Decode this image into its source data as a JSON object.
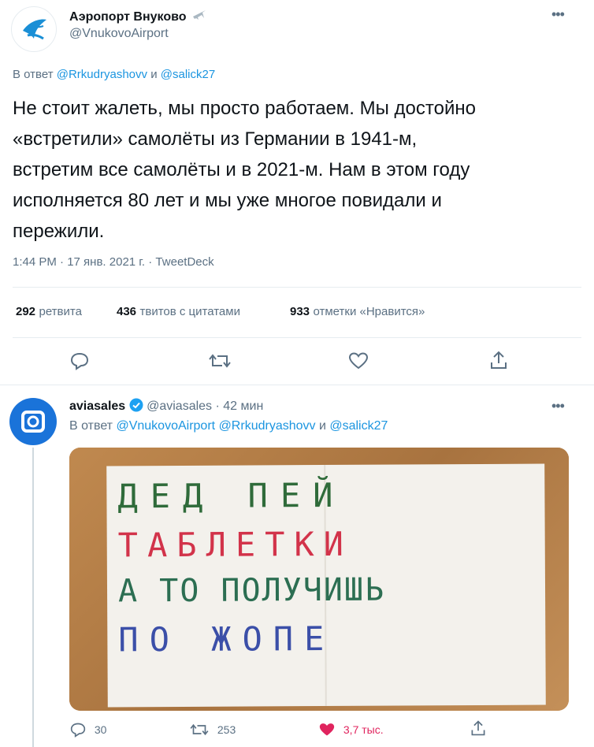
{
  "tweet1": {
    "author_name": "Аэропорт Внуково",
    "author_handle": "@VnukovoAirport",
    "reply_prefix": "В ответ",
    "reply_to_1": "@Rrkudryashovv",
    "reply_and": "и",
    "reply_to_2": "@salick27",
    "text_lines": [
      "Не стоит жалеть, мы просто работаем. Мы достойно",
      "«встретили» самолёты из Германии в 1941-м,",
      "встретим все самолёты и в 2021-м. Нам в этом году",
      "исполняется 80 лет и мы уже многое повидали и",
      "пережили."
    ],
    "meta": "1:44 PM · 17 янв. 2021 г. · TweetDeck",
    "stats": {
      "retweets_count": "292",
      "retweets_label": "ретвита",
      "quotes_count": "436",
      "quotes_label": "твитов с цитатами",
      "likes_count": "933",
      "likes_label": "отметки «Нравится»"
    }
  },
  "tweet2": {
    "author_name": "aviasales",
    "author_handle": "@aviasales",
    "time": "· 42 мин",
    "reply_prefix": "В ответ",
    "reply_to_1": "@VnukovoAirport",
    "reply_to_2": "@Rrkudryashovv",
    "reply_and": "и",
    "reply_to_3": "@salick27",
    "note_lines": [
      "ДЕД ПЕЙ",
      "ТАБЛЕТКИ",
      "А ТО ПОЛУЧИШЬ",
      "ПО ЖОПЕ"
    ],
    "actions": {
      "replies": "30",
      "retweets": "253",
      "likes": "3,7 тыс."
    }
  },
  "colors": {
    "link": "#1b95e0",
    "muted": "#5b7083",
    "like": "#e0245e",
    "verified": "#1da1f2"
  }
}
